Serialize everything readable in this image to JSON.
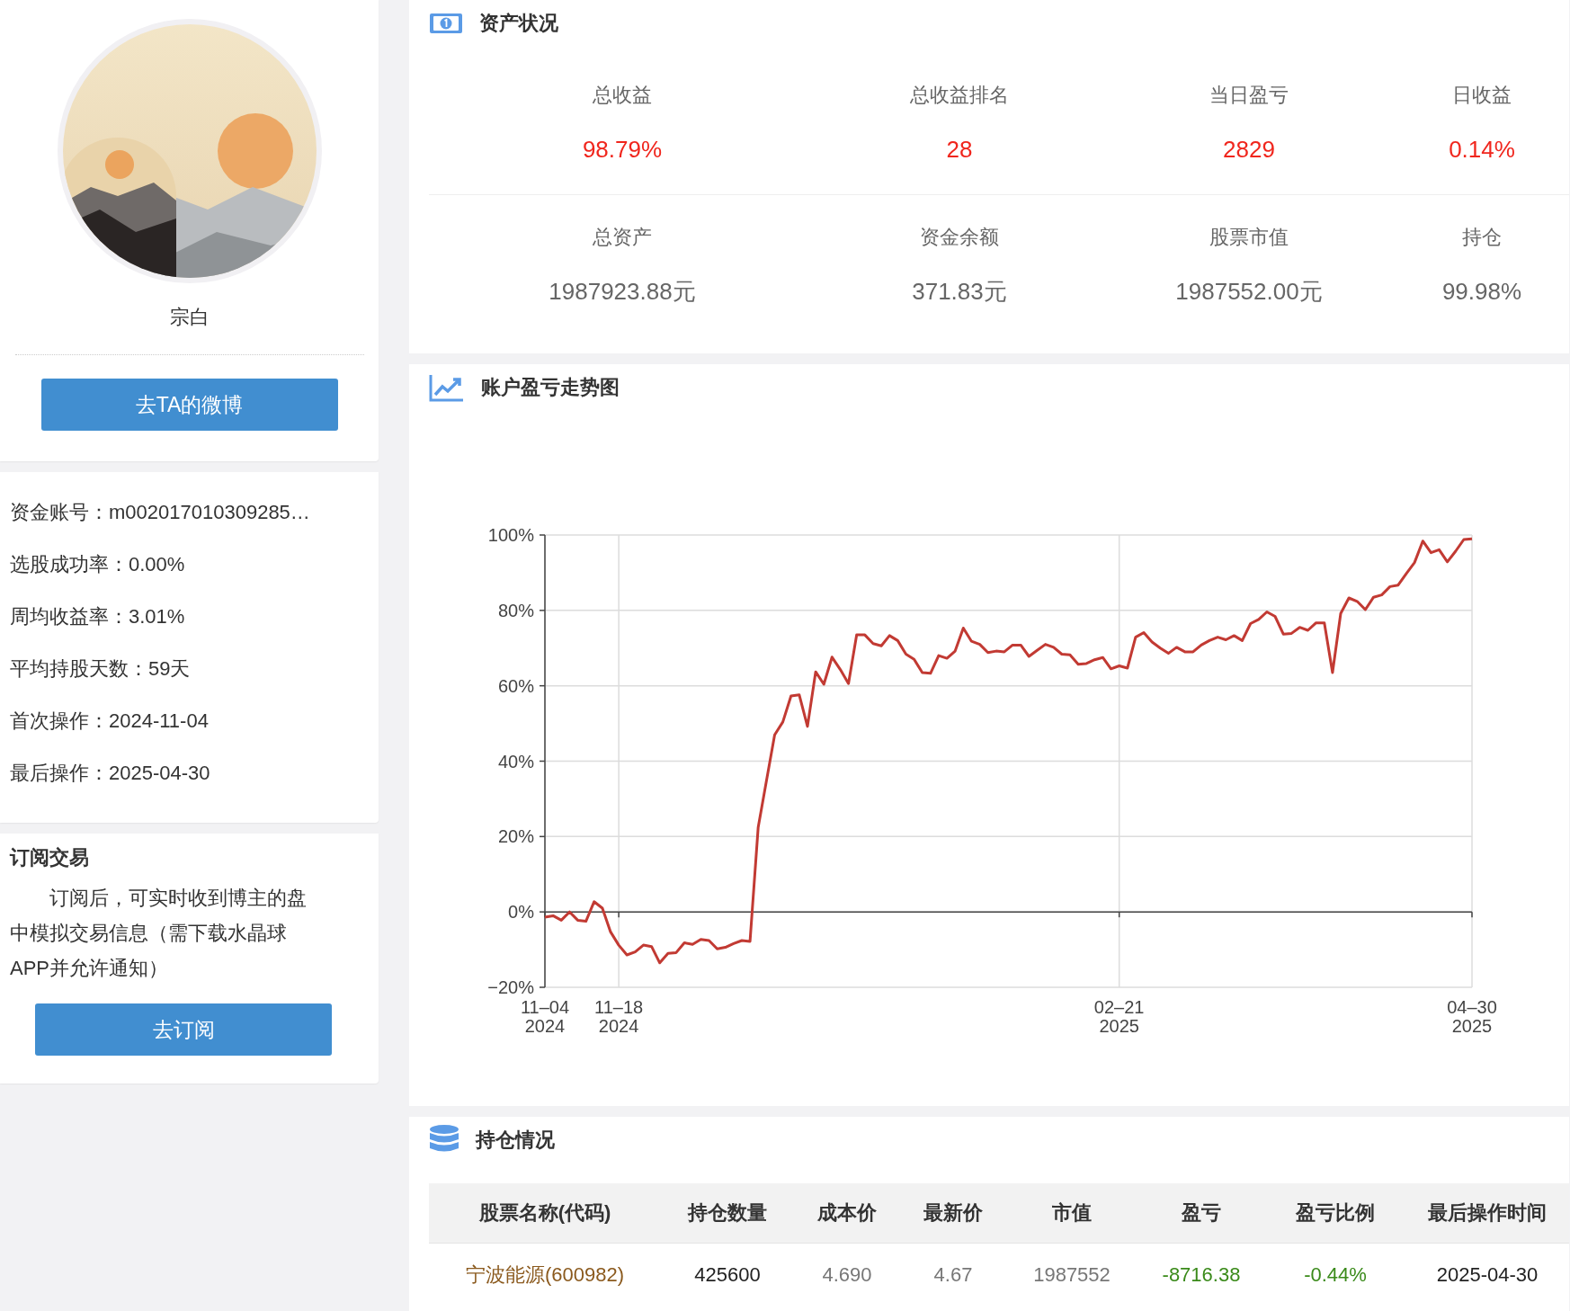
{
  "profile": {
    "name": "宗白",
    "weibo_button": "去TA的微博"
  },
  "info": [
    "资金账号：m002017010309285…",
    "选股成功率：0.00%",
    "周均收益率：3.01%",
    "平均持股天数：59天",
    "首次操作：2024-11-04",
    "最后操作：2025-04-30"
  ],
  "subscribe": {
    "title": "订阅交易",
    "text": "订阅后，可实时收到博主的盘中模拟交易信息（需下载水晶球APP并允许通知）",
    "button": "去订阅"
  },
  "assets": {
    "title": "资产状况",
    "rows": [
      [
        {
          "label": "总收益",
          "value": "98.79%",
          "kind": "gain"
        },
        {
          "label": "总收益排名",
          "value": "28",
          "kind": "gain"
        },
        {
          "label": "当日盈亏",
          "value": "2829",
          "kind": "gain"
        },
        {
          "label": "日收益",
          "value": "0.14%",
          "kind": "gain"
        }
      ],
      [
        {
          "label": "总资产",
          "value": "1987923.88元",
          "kind": "plain"
        },
        {
          "label": "资金余额",
          "value": "371.83元",
          "kind": "plain"
        },
        {
          "label": "股票市值",
          "value": "1987552.00元",
          "kind": "plain"
        },
        {
          "label": "持仓",
          "value": "99.98%",
          "kind": "plain"
        }
      ]
    ]
  },
  "trend": {
    "title": "账户盈亏走势图",
    "chart_data": {
      "type": "line",
      "categories": [
        "11–04 2024",
        null,
        null,
        null,
        null,
        null,
        null,
        null,
        null,
        "11–18 2024",
        null,
        null,
        null,
        null,
        null,
        null,
        null,
        null,
        null,
        null,
        null,
        null,
        null,
        null,
        null,
        null,
        null,
        null,
        null,
        null,
        null,
        null,
        null,
        null,
        null,
        null,
        null,
        null,
        null,
        null,
        null,
        null,
        null,
        null,
        null,
        null,
        null,
        null,
        null,
        null,
        null,
        null,
        null,
        null,
        null,
        null,
        null,
        null,
        null,
        null,
        null,
        null,
        null,
        null,
        null,
        null,
        null,
        null,
        null,
        null,
        "02–21 2025",
        null,
        null,
        null,
        null,
        null,
        null,
        null,
        null,
        null,
        null,
        null,
        null,
        null,
        null,
        null,
        null,
        null,
        null,
        null,
        null,
        null,
        null,
        null,
        null,
        null,
        null,
        null,
        null,
        null,
        null,
        null,
        null,
        null,
        null,
        null,
        null,
        null,
        null,
        null,
        null,
        null,
        null,
        "04–30 2025"
      ],
      "series": [
        {
          "color": "#c23a33",
          "values": [
            -1.4,
            -1,
            -2.2,
            0,
            -2.2,
            -2.5,
            2.7,
            1,
            -5.3,
            -8.8,
            -11.4,
            -10.6,
            -8.8,
            -9.2,
            -13.5,
            -11,
            -10.8,
            -8.2,
            -8.6,
            -7.3,
            -7.6,
            -9.8,
            -9.4,
            -8.4,
            -7.6,
            -7.8,
            22.5,
            34.7,
            47,
            50.4,
            57.3,
            57.6,
            49.2,
            63.7,
            60.4,
            67.6,
            64.3,
            60.6,
            73.5,
            73.5,
            71.2,
            70.6,
            73.3,
            72,
            68.4,
            67,
            63.5,
            63.3,
            68,
            67.3,
            69.2,
            75.3,
            71.8,
            71,
            68.8,
            69.2,
            69,
            70.8,
            70.8,
            67.8,
            69.4,
            71,
            70.2,
            68.4,
            68.2,
            65.7,
            65.9,
            66.9,
            67.5,
            64.5,
            65.3,
            64.7,
            72.9,
            74.1,
            71.6,
            70,
            68.6,
            70.2,
            69,
            69,
            70.8,
            72,
            72.9,
            72.2,
            73.3,
            72,
            76.5,
            77.6,
            79.6,
            78.4,
            73.7,
            73.9,
            75.5,
            74.7,
            76.7,
            76.7,
            63.5,
            79.2,
            83.3,
            82.4,
            80.2,
            83.5,
            84.1,
            86.3,
            86.7,
            89.8,
            92.7,
            98.4,
            95.3,
            96.1,
            92.9,
            95.7,
            98.8,
            99
          ]
        }
      ],
      "ylim": [
        -20,
        100
      ],
      "grid": true,
      "yticks": [
        {
          "value": 100,
          "label": "100%"
        },
        {
          "value": 80,
          "label": "80%"
        },
        {
          "value": 60,
          "label": "60%"
        },
        {
          "value": 40,
          "label": "40%"
        },
        {
          "value": 20,
          "label": "20%"
        },
        {
          "value": 0,
          "label": "0%"
        },
        {
          "value": -20,
          "label": "−20%"
        }
      ]
    }
  },
  "holdings": {
    "title": "持仓情况",
    "columns": [
      "股票名称(代码)",
      "持仓数量",
      "成本价",
      "最新价",
      "市值",
      "盈亏",
      "盈亏比例",
      "最后操作时间"
    ],
    "rows": [
      [
        {
          "text": "宁波能源(600982)",
          "kind": "stock"
        },
        {
          "text": "425600",
          "kind": "plain"
        },
        {
          "text": "4.690",
          "kind": "muted"
        },
        {
          "text": "4.67",
          "kind": "muted"
        },
        {
          "text": "1987552",
          "kind": "muted"
        },
        {
          "text": "-8716.38",
          "kind": "loss"
        },
        {
          "text": "-0.44%",
          "kind": "loss"
        },
        {
          "text": "2025-04-30",
          "kind": "plain"
        }
      ]
    ]
  }
}
